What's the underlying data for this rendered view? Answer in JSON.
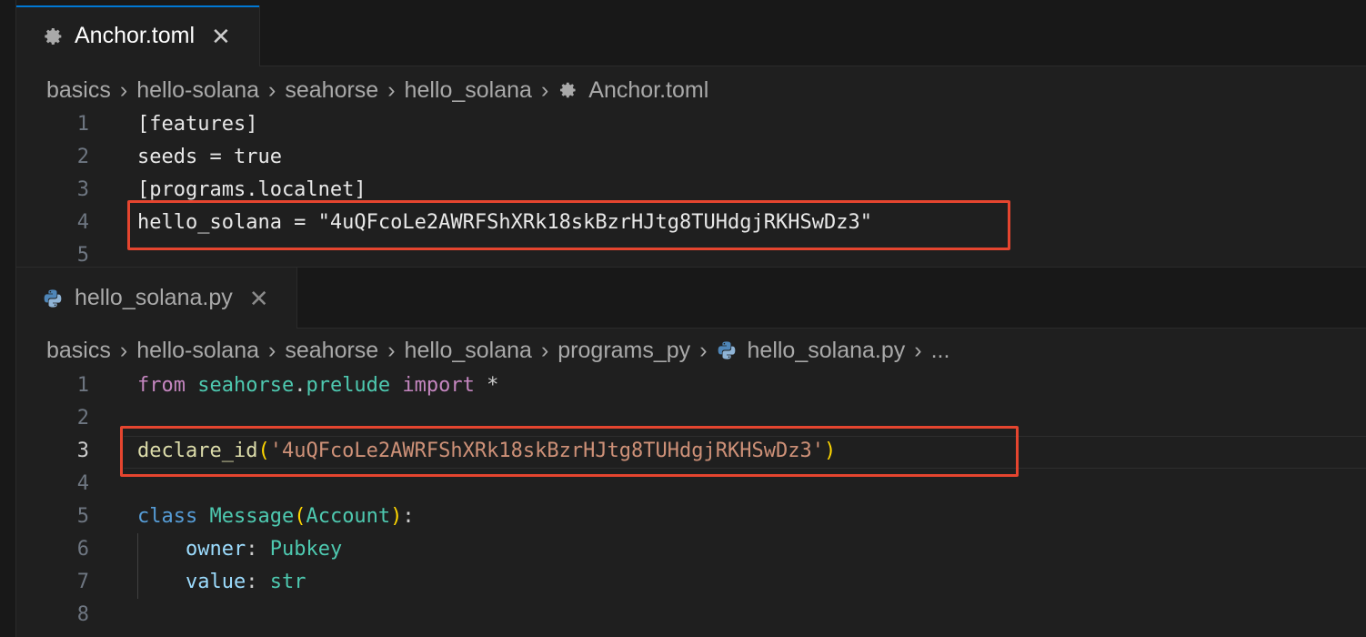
{
  "top_editor": {
    "tab": {
      "label": "Anchor.toml",
      "icon": "gear-icon"
    },
    "breadcrumb": [
      "basics",
      "hello-solana",
      "seahorse",
      "hello_solana",
      "Anchor.toml"
    ],
    "lines": [
      {
        "num": "1",
        "text": "[features]"
      },
      {
        "num": "2",
        "text": "seeds = true"
      },
      {
        "num": "3",
        "text": "[programs.localnet]"
      },
      {
        "num": "4",
        "text": "hello_solana = \"4uQFcoLe2AWRFShXRk18skBzrHJtg8TUHdgjRKHSwDz3\""
      },
      {
        "num": "5",
        "text": ""
      }
    ]
  },
  "bottom_editor": {
    "tab": {
      "label": "hello_solana.py",
      "icon": "python-icon"
    },
    "breadcrumb": [
      "basics",
      "hello-solana",
      "seahorse",
      "hello_solana",
      "programs_py",
      "hello_solana.py",
      "..."
    ],
    "line_numbers": [
      "1",
      "2",
      "3",
      "4",
      "5",
      "6",
      "7",
      "8"
    ],
    "code": {
      "l1": {
        "kw_from": "from",
        "module": "seahorse",
        "dot": ".",
        "submodule": "prelude",
        "kw_import": "import",
        "star": "*"
      },
      "l3": {
        "fn": "declare_id",
        "open": "(",
        "str": "'4uQFcoLe2AWRFShXRk18skBzrHJtg8TUHdgjRKHSwDz3'",
        "close": ")"
      },
      "l5": {
        "kw_class": "class",
        "name": "Message",
        "open": "(",
        "base": "Account",
        "close": ")",
        "colon": ":"
      },
      "l6": {
        "field": "owner",
        "colon": ":",
        "type": "Pubkey"
      },
      "l7": {
        "field": "value",
        "colon": ":",
        "type": "str"
      }
    }
  },
  "colors": {
    "highlight_box": "#e5452f",
    "tab_accent": "#0078d4"
  }
}
